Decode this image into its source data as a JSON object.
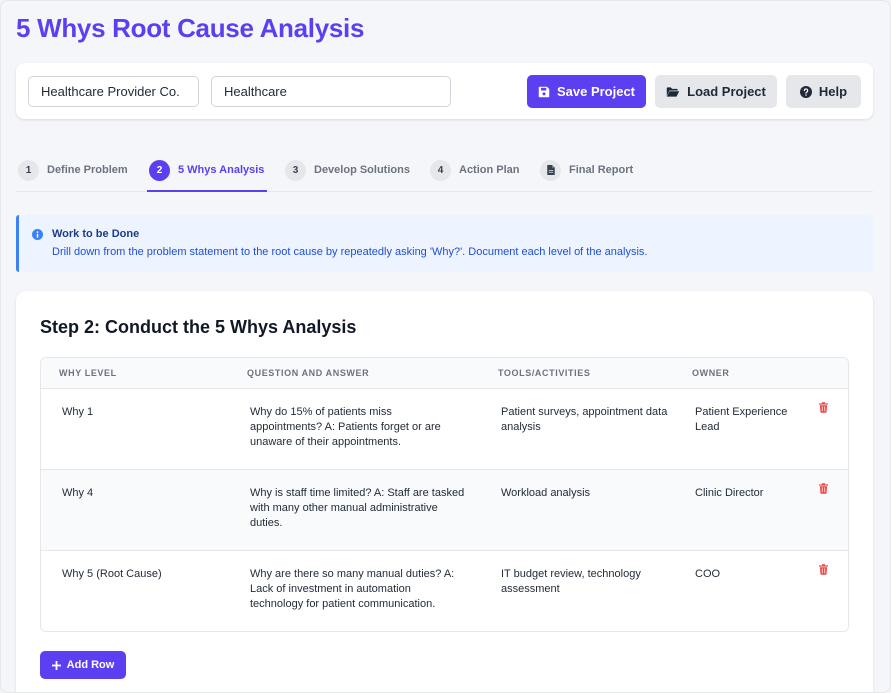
{
  "header": {
    "title": "5 Whys Root Cause Analysis"
  },
  "project": {
    "company_value": "Healthcare Provider Co.",
    "industry_value": "Healthcare",
    "save_label": "Save Project",
    "load_label": "Load Project",
    "help_label": "Help"
  },
  "tabs": [
    {
      "num": "1",
      "label": "Define Problem",
      "icon": ""
    },
    {
      "num": "2",
      "label": "5 Whys Analysis",
      "icon": ""
    },
    {
      "num": "3",
      "label": "Develop Solutions",
      "icon": ""
    },
    {
      "num": "4",
      "label": "Action Plan",
      "icon": ""
    },
    {
      "num": "",
      "label": "Final Report",
      "icon": "file-icon"
    }
  ],
  "active_tab": 1,
  "notice": {
    "title": "Work to be Done",
    "text": "Drill down from the problem statement to the root cause by repeatedly asking 'Why?'. Document each level of the analysis."
  },
  "analysis": {
    "title": "Step 2: Conduct the 5 Whys Analysis",
    "columns": [
      "Why Level",
      "Question and Answer",
      "Tools/Activities",
      "Owner"
    ],
    "rows": [
      {
        "level": "Why 1",
        "qa": "Why do 15% of patients miss appointments? A: Patients forget or are unaware of their appointments.",
        "tools": "Patient surveys, appointment data analysis",
        "owner": "Patient Experience Lead"
      },
      {
        "level": "Why 4",
        "qa": "Why is staff time limited? A: Staff are tasked with many other manual administrative duties.",
        "tools": "Workload analysis",
        "owner": "Clinic Director"
      },
      {
        "level": "Why 5 (Root Cause)",
        "qa": "Why are there so many manual duties? A: Lack of investment in automation technology for patient communication.",
        "tools": "IT budget review, technology assessment",
        "owner": "COO"
      }
    ],
    "add_label": "Add Row"
  },
  "colors": {
    "accent": "#5b3ff0",
    "danger": "#ef4444",
    "info": "#3b82f6"
  }
}
